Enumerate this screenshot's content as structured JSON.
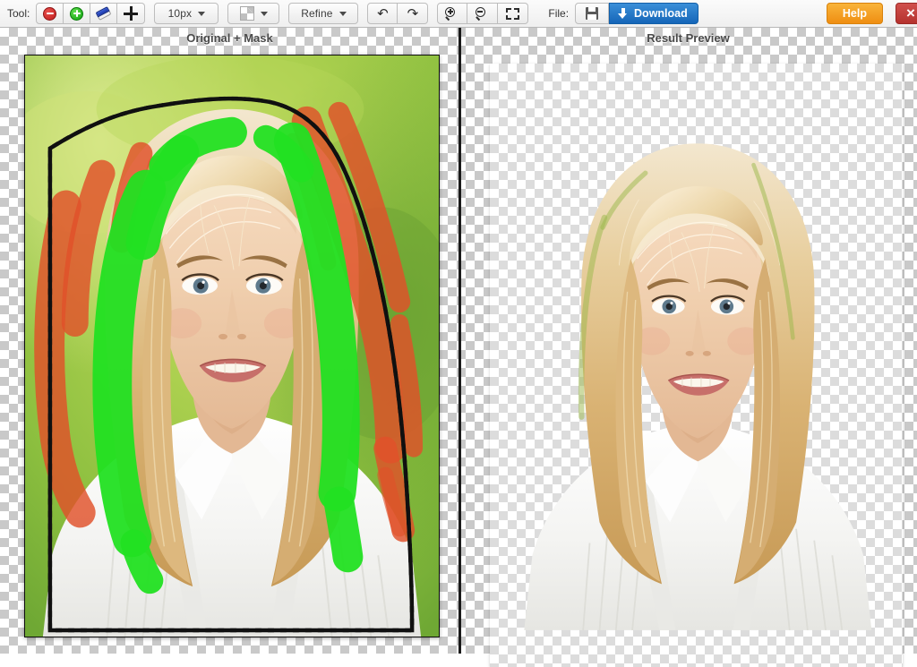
{
  "toolbar": {
    "tool_label": "Tool:",
    "file_label": "File:",
    "tools": [
      {
        "name": "exclude-brush",
        "icon": "minus-circle-icon",
        "label": ""
      },
      {
        "name": "include-brush",
        "icon": "plus-circle-icon",
        "label": ""
      },
      {
        "name": "eraser",
        "icon": "eraser-icon",
        "label": ""
      },
      {
        "name": "move",
        "icon": "move-icon",
        "label": ""
      }
    ],
    "brush_size": "10px",
    "background_mode_icon": "checkerboard-icon",
    "refine_label": "Refine",
    "undo_icon": "undo-icon",
    "redo_icon": "redo-icon",
    "zoom_in_icon": "zoom-in-icon",
    "zoom_out_icon": "zoom-out-icon",
    "fit_icon": "fit-to-screen-icon",
    "save_icon": "floppy-disk-icon",
    "download_label": "Download",
    "help_label": "Help",
    "close_label": "×",
    "colors": {
      "download_blue": "#1565b8",
      "help_orange": "#ef8e12",
      "close_red": "#b5322e",
      "exclude_red": "#e0502a",
      "include_green": "#22e022",
      "selection_yellow": "#d8d463"
    }
  },
  "panels": {
    "left_title": "Original + Mask",
    "right_title": "Result Preview"
  }
}
